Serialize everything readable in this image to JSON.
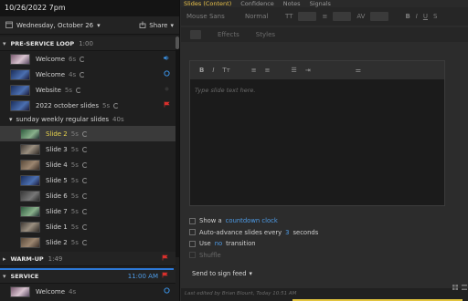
{
  "app": {
    "datetime": "10/26/2022 7pm"
  },
  "left": {
    "date": "Wednesday, October 26",
    "share_label": "Share",
    "sections": [
      {
        "name": "PRE-SERVICE LOOP",
        "dur": "1:00"
      },
      {
        "name": "WARM-UP",
        "dur": "1:49"
      },
      {
        "name": "SERVICE",
        "dur": "11:00 AM"
      }
    ],
    "pre_items": [
      {
        "label": "Welcome",
        "dur": "6s",
        "status": "speaker-icon"
      },
      {
        "label": "Welcome",
        "dur": "4s",
        "status": "circle-icon"
      },
      {
        "label": "Website",
        "dur": "5s",
        "status": "blank"
      },
      {
        "label": "2022 october slides",
        "dur": "5s",
        "status": "red-flag-icon"
      }
    ],
    "group": {
      "label": "sunday weekly regular slides",
      "dur": "40s"
    },
    "slides": [
      {
        "label": "Slide 2",
        "dur": "5s"
      },
      {
        "label": "Slide 3",
        "dur": "5s"
      },
      {
        "label": "Slide 4",
        "dur": "5s"
      },
      {
        "label": "Slide 5",
        "dur": "5s"
      },
      {
        "label": "Slide 6",
        "dur": "5s"
      },
      {
        "label": "Slide 7",
        "dur": "5s"
      },
      {
        "label": "Slide 1",
        "dur": "5s"
      },
      {
        "label": "Slide 2",
        "dur": "5s"
      }
    ],
    "service_item": {
      "label": "Welcome",
      "dur": "4s"
    }
  },
  "right": {
    "tabs": [
      "Slides (Content)",
      "Confidence",
      "Notes",
      "Signals"
    ],
    "toolbar1": {
      "style_label": "Mouse Sans",
      "weight_label": "Normal",
      "size_icon": "TT"
    },
    "toolbar2": {
      "effects": "Effects",
      "styles": "Styles"
    },
    "editor": {
      "placeholder": "Type slide text here."
    },
    "options": {
      "show_a": "Show a",
      "countdown": "countdown clock",
      "auto_advance": "Auto-advance slides every",
      "seconds_n": "3",
      "seconds": "seconds",
      "use": "Use",
      "no": "no",
      "transition": "transition",
      "shuffle": "Shuffle"
    },
    "send_feed": "Send to sign feed",
    "footer": "Last edited by Brian Blount, Today 10:51 AM"
  },
  "colors": {
    "accent": "#e8c14a",
    "link": "#4e9ce8",
    "alert": "#d9302c"
  }
}
